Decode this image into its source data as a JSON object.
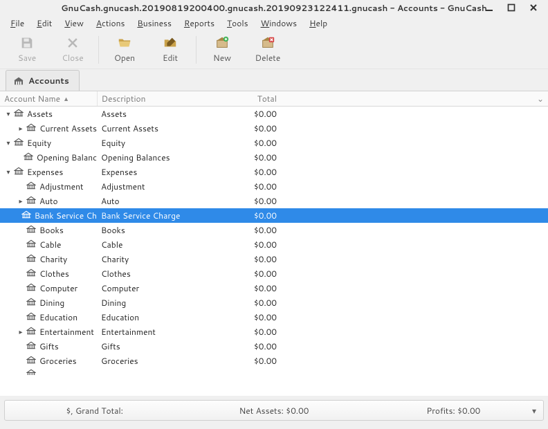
{
  "window": {
    "title": "GnuCash.gnucash.20190819200400.gnucash.20190923122411.gnucash - Accounts - GnuCash"
  },
  "menubar": {
    "items": [
      {
        "label": "File",
        "u": 0
      },
      {
        "label": "Edit",
        "u": 0
      },
      {
        "label": "View",
        "u": 0
      },
      {
        "label": "Actions",
        "u": 0
      },
      {
        "label": "Business",
        "u": 0
      },
      {
        "label": "Reports",
        "u": 0
      },
      {
        "label": "Tools",
        "u": 0
      },
      {
        "label": "Windows",
        "u": 0
      },
      {
        "label": "Help",
        "u": 0
      }
    ]
  },
  "toolbar": {
    "save": "Save",
    "close": "Close",
    "open": "Open",
    "edit": "Edit",
    "new": "New",
    "delete": "Delete"
  },
  "tab": {
    "label": "Accounts"
  },
  "columns": {
    "name": "Account Name",
    "desc": "Description",
    "total": "Total"
  },
  "tree": [
    {
      "indent": 0,
      "expander": "down",
      "name": "Assets",
      "desc": "Assets",
      "total": "$0.00",
      "selected": false
    },
    {
      "indent": 1,
      "expander": "right",
      "name": "Current Assets",
      "desc": "Current Assets",
      "total": "$0.00",
      "selected": false
    },
    {
      "indent": 0,
      "expander": "down",
      "name": "Equity",
      "desc": "Equity",
      "total": "$0.00",
      "selected": false
    },
    {
      "indent": 1,
      "expander": "none",
      "name": "Opening Balances",
      "desc": "Opening Balances",
      "total": "$0.00",
      "selected": false,
      "clip": true
    },
    {
      "indent": 0,
      "expander": "down",
      "name": "Expenses",
      "desc": "Expenses",
      "total": "$0.00",
      "selected": false
    },
    {
      "indent": 1,
      "expander": "none",
      "name": "Adjustment",
      "desc": "Adjustment",
      "total": "$0.00",
      "selected": false
    },
    {
      "indent": 1,
      "expander": "right",
      "name": "Auto",
      "desc": "Auto",
      "total": "$0.00",
      "selected": false
    },
    {
      "indent": 1,
      "expander": "none",
      "name": "Bank Service Charge",
      "desc": "Bank Service Charge",
      "total": "$0.00",
      "selected": true,
      "clip": true
    },
    {
      "indent": 1,
      "expander": "none",
      "name": "Books",
      "desc": "Books",
      "total": "$0.00",
      "selected": false
    },
    {
      "indent": 1,
      "expander": "none",
      "name": "Cable",
      "desc": "Cable",
      "total": "$0.00",
      "selected": false
    },
    {
      "indent": 1,
      "expander": "none",
      "name": "Charity",
      "desc": "Charity",
      "total": "$0.00",
      "selected": false
    },
    {
      "indent": 1,
      "expander": "none",
      "name": "Clothes",
      "desc": "Clothes",
      "total": "$0.00",
      "selected": false
    },
    {
      "indent": 1,
      "expander": "none",
      "name": "Computer",
      "desc": "Computer",
      "total": "$0.00",
      "selected": false
    },
    {
      "indent": 1,
      "expander": "none",
      "name": "Dining",
      "desc": "Dining",
      "total": "$0.00",
      "selected": false
    },
    {
      "indent": 1,
      "expander": "none",
      "name": "Education",
      "desc": "Education",
      "total": "$0.00",
      "selected": false
    },
    {
      "indent": 1,
      "expander": "right",
      "name": "Entertainment",
      "desc": "Entertainment",
      "total": "$0.00",
      "selected": false
    },
    {
      "indent": 1,
      "expander": "none",
      "name": "Gifts",
      "desc": "Gifts",
      "total": "$0.00",
      "selected": false
    },
    {
      "indent": 1,
      "expander": "none",
      "name": "Groceries",
      "desc": "Groceries",
      "total": "$0.00",
      "selected": false
    }
  ],
  "statusbar": {
    "grand_total": "$, Grand Total:",
    "net_assets": "Net Assets: $0.00",
    "profits": "Profits: $0.00"
  }
}
